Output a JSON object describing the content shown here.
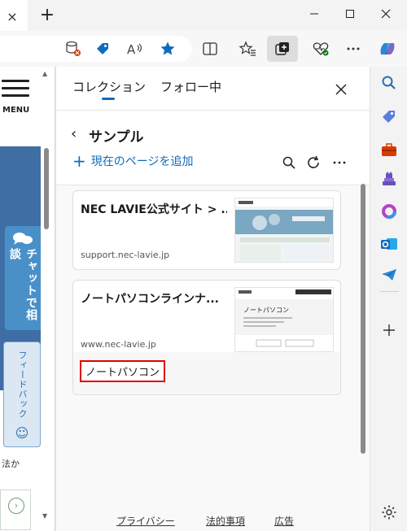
{
  "window": {
    "close_tab_glyph": "×",
    "new_tab_glyph": "+"
  },
  "page": {
    "menu_label": "MENU",
    "chat_label": "チャットで相談",
    "feedback_label": "フィードバック",
    "snippet_text": "法か"
  },
  "collections": {
    "tabs": [
      {
        "label": "コレクション",
        "active": true
      },
      {
        "label": "フォロー中",
        "active": false
      }
    ],
    "collection_name": "サンプル",
    "add_current_page_label": "現在のページを追加",
    "cards": [
      {
        "title": "NEC LAVIE公式サイト > ...",
        "url": "support.nec-lavie.jp",
        "note": ""
      },
      {
        "title": "ノートパソコンラインナ...",
        "url": "www.nec-lavie.jp",
        "thumb_heading": "ノートパソコン",
        "note": "ノートパソコン"
      }
    ],
    "footer": {
      "privacy": "プライバシー",
      "legal": "法的事項",
      "ads": "広告"
    }
  },
  "colors": {
    "accent": "#0f6cbd",
    "note_border": "#e00000",
    "hero_blue": "#3f6ea5"
  },
  "icons": {
    "toolbar": [
      "database-blocked-icon",
      "tag-icon",
      "read-aloud-icon",
      "favorite-star-icon",
      "split-screen-icon",
      "favorites-icon",
      "collections-icon",
      "health-icon",
      "more-icon",
      "copilot-icon"
    ],
    "sidebar": [
      "search-icon",
      "tag-icon",
      "toolbox-icon",
      "games-icon",
      "microsoft365-icon",
      "outlook-icon",
      "telegram-icon",
      "add-icon",
      "settings-icon"
    ]
  }
}
